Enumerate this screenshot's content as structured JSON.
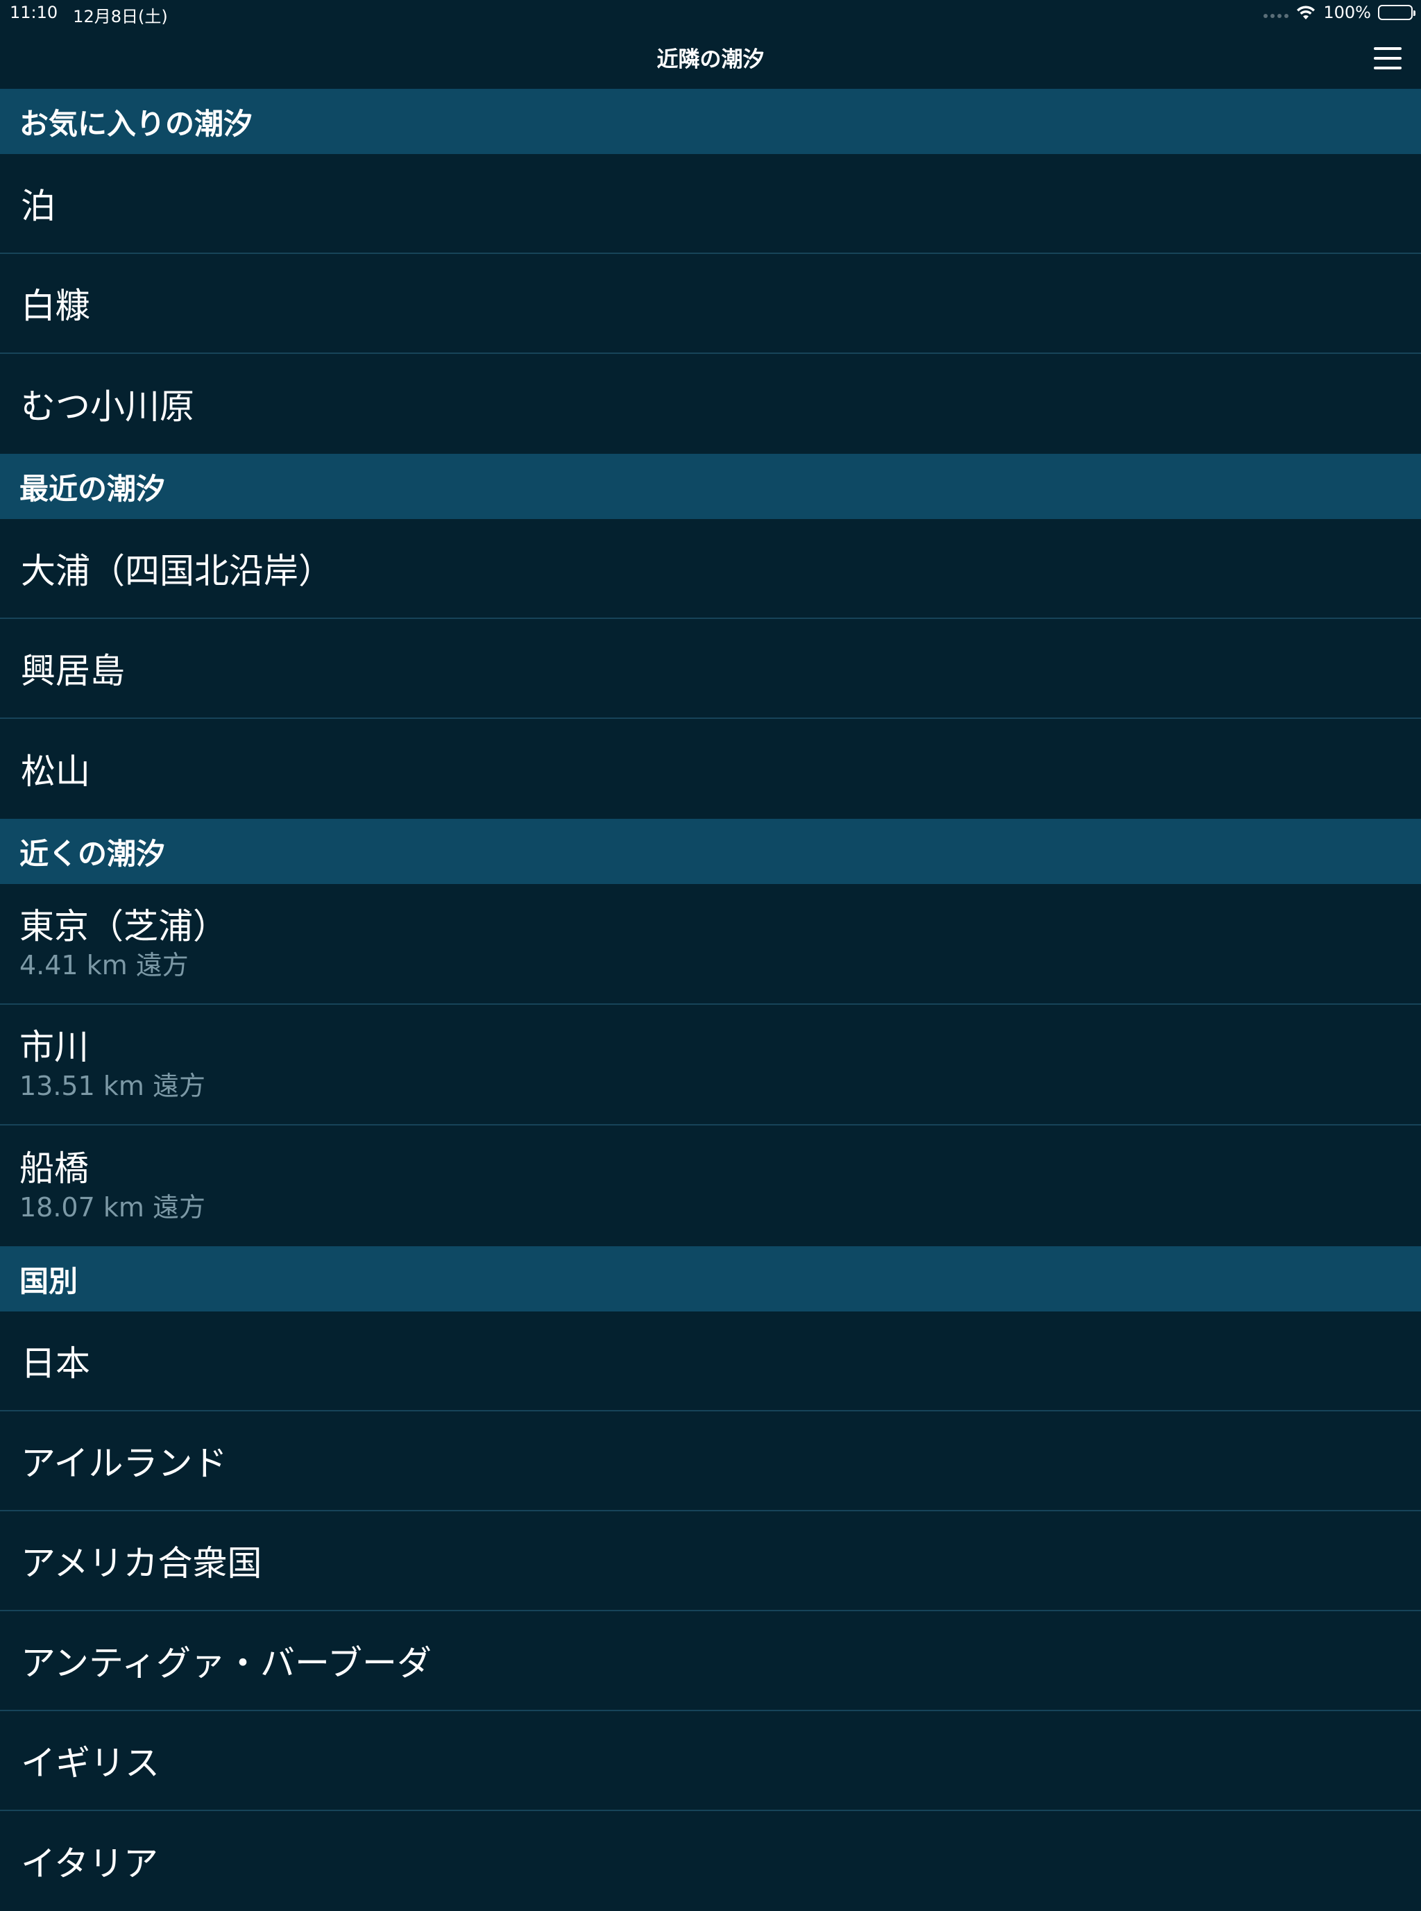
{
  "status_bar": {
    "time": "11:10",
    "date": "12月8日(土)",
    "battery": "100%",
    "icons": [
      "signal-dots-icon",
      "wifi-icon",
      "battery-icon"
    ]
  },
  "nav": {
    "title": "近隣の潮汐",
    "menu_icon": "hamburger-menu-icon"
  },
  "sections": {
    "favorites": {
      "header": "お気に入りの潮汐",
      "items": [
        "泊",
        "白糠",
        "むつ小川原"
      ]
    },
    "recent": {
      "header": "最近の潮汐",
      "items": [
        "大浦（四国北沿岸）",
        "興居島",
        "松山"
      ]
    },
    "nearby": {
      "header": "近くの潮汐",
      "items": [
        {
          "name": "東京（芝浦）",
          "distance": "4.41 km 遠方"
        },
        {
          "name": "市川",
          "distance": "13.51 km 遠方"
        },
        {
          "name": "船橋",
          "distance": "18.07 km 遠方"
        }
      ]
    },
    "by_country": {
      "header": "国別",
      "items": [
        "日本",
        "アイルランド",
        "アメリカ合衆国",
        "アンティグァ・バーブーダ",
        "イギリス",
        "イタリア"
      ]
    }
  },
  "colors": {
    "background": "#04212f",
    "section_header": "#0e4964",
    "separator": "#174459",
    "secondary_text": "#7c99a6"
  }
}
